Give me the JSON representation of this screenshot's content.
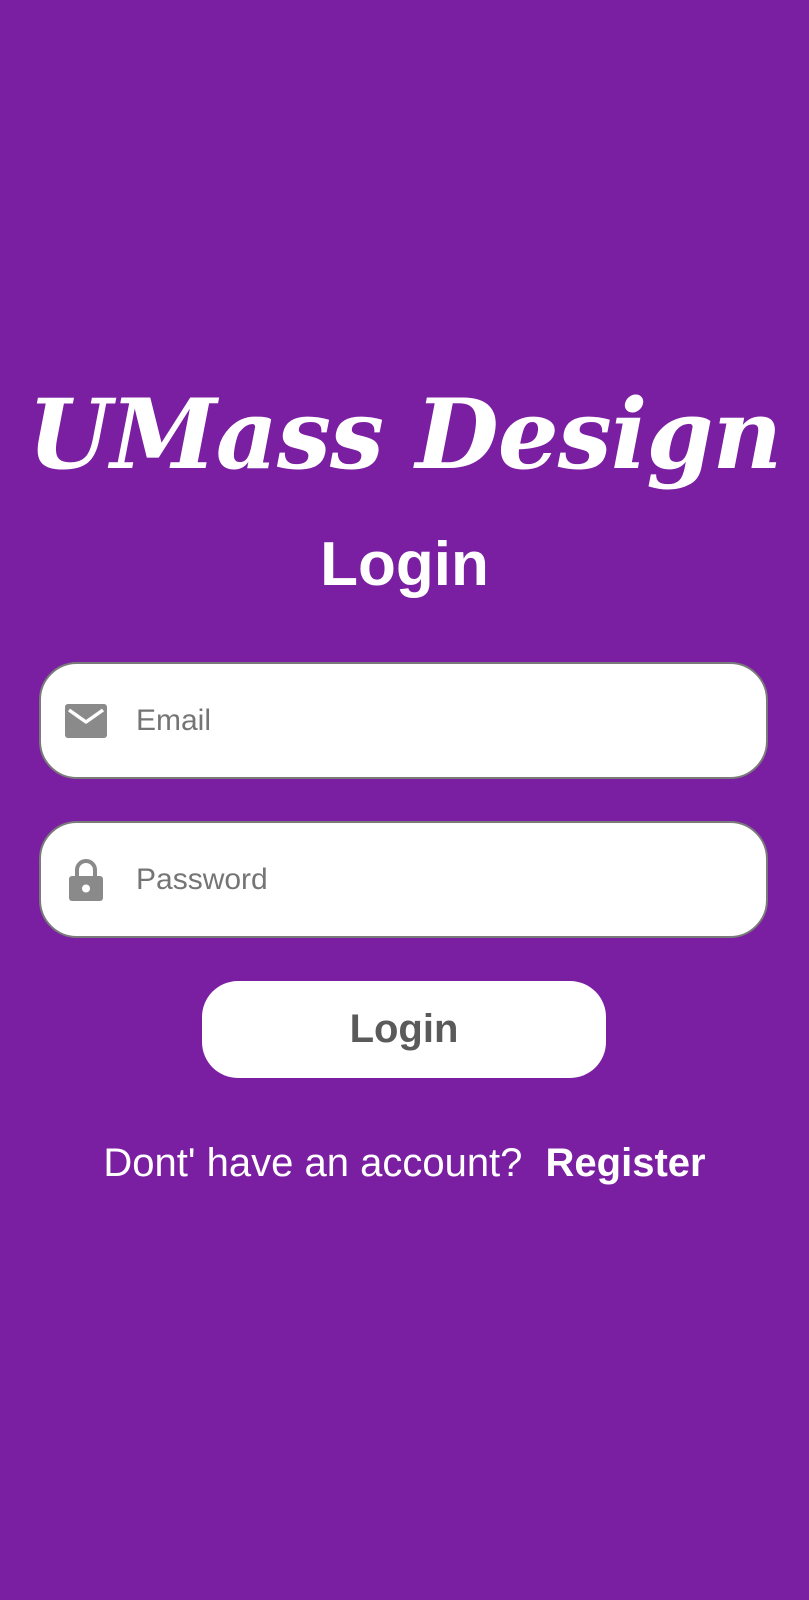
{
  "brand": {
    "title": "UMass Design"
  },
  "header": {
    "title": "Login"
  },
  "form": {
    "email": {
      "placeholder": "Email",
      "value": "",
      "icon": "email-icon"
    },
    "password": {
      "placeholder": "Password",
      "value": "",
      "icon": "lock-icon"
    },
    "submit_label": "Login"
  },
  "footer": {
    "prompt": "Dont' have an account?",
    "register_label": "Register"
  },
  "colors": {
    "background": "#7b1fa2",
    "field_background": "#ffffff",
    "icon": "#8a8a8a",
    "button_text": "#5a5a5a"
  }
}
